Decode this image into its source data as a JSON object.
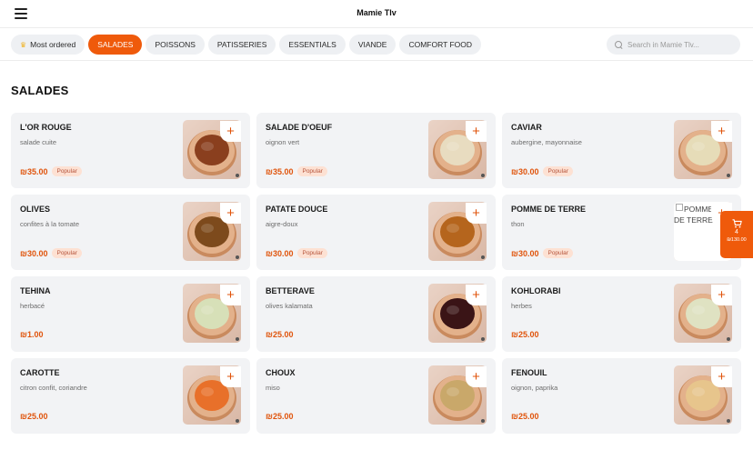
{
  "header": {
    "title": "Mamie Tlv"
  },
  "categories": [
    {
      "label": "Most ordered",
      "icon": "crown-icon",
      "active": false
    },
    {
      "label": "SALADES",
      "active": true
    },
    {
      "label": "POISSONS",
      "active": false
    },
    {
      "label": "PATISSERIES",
      "active": false
    },
    {
      "label": "ESSENTIALS",
      "active": false
    },
    {
      "label": "VIANDE",
      "active": false
    },
    {
      "label": "COMFORT FOOD",
      "active": false
    }
  ],
  "search": {
    "placeholder": "Search in Mamie Tlv..."
  },
  "section": {
    "title": "SALADES"
  },
  "colors": {
    "accent": "#ef5a0b",
    "card_bg": "#f2f3f5",
    "price": "#e0540c",
    "badge_bg": "#fde1d3"
  },
  "items": [
    {
      "name": "L'OR ROUGE",
      "desc": "salade cuite",
      "price": "₪35.00",
      "badge": "Popular",
      "food": "#8a3f1e"
    },
    {
      "name": "SALADE D'OEUF",
      "desc": "oignon vert",
      "price": "₪35.00",
      "badge": "Popular",
      "food": "#e8dcc0"
    },
    {
      "name": "CAVIAR",
      "desc": "aubergine, mayonnaise",
      "price": "₪30.00",
      "badge": "Popular",
      "food": "#e6dcb8"
    },
    {
      "name": "OLIVES",
      "desc": "confites à la tomate",
      "price": "₪30.00",
      "badge": "Popular",
      "food": "#7d4a1c"
    },
    {
      "name": "PATATE DOUCE",
      "desc": "aigre-doux",
      "price": "₪30.00",
      "badge": "Popular",
      "food": "#b5651d"
    },
    {
      "name": "POMME DE TERRE",
      "desc": "thon",
      "price": "₪30.00",
      "badge": "Popular",
      "broken_alt": "POMME DE TERRE"
    },
    {
      "name": "TEHINA",
      "desc": "herbacé",
      "price": "₪1.00",
      "badge": "",
      "food": "#d7e0b8"
    },
    {
      "name": "BETTERAVE",
      "desc": "olives kalamata",
      "price": "₪25.00",
      "badge": "",
      "food": "#3a1416"
    },
    {
      "name": "KOHLORABI",
      "desc": "herbes",
      "price": "₪25.00",
      "badge": "",
      "food": "#dfe2c2"
    },
    {
      "name": "CAROTTE",
      "desc": "citron confit, coriandre",
      "price": "₪25.00",
      "badge": "",
      "food": "#e8702a"
    },
    {
      "name": "CHOUX",
      "desc": "miso",
      "price": "₪25.00",
      "badge": "",
      "food": "#c9a86a"
    },
    {
      "name": "FENOUIL",
      "desc": "oignon, paprika",
      "price": "₪25.00",
      "badge": "",
      "food": "#e7c58c"
    }
  ],
  "cart": {
    "count": "4",
    "total": "₪130.00"
  }
}
